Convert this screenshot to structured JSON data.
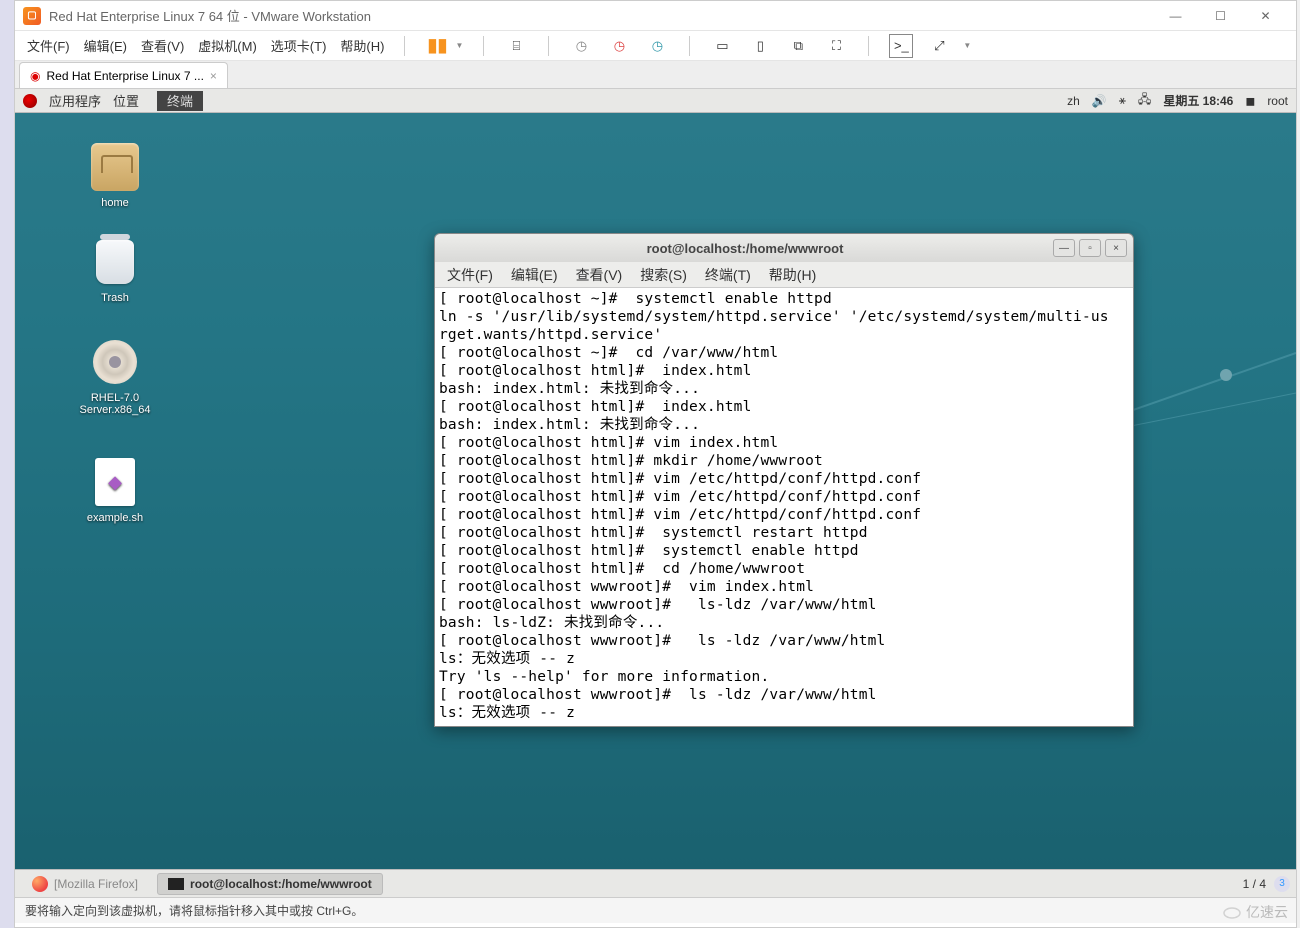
{
  "vmware": {
    "title": "Red Hat Enterprise Linux 7 64 位 - VMware Workstation",
    "menus": [
      "文件(F)",
      "编辑(E)",
      "查看(V)",
      "虚拟机(M)",
      "选项卡(T)",
      "帮助(H)"
    ],
    "tab_label": "Red Hat Enterprise Linux 7 ...",
    "statusbar": "要将输入定向到该虚拟机，请将鼠标指针移入其中或按 Ctrl+G。"
  },
  "gnome": {
    "apps_label": "应用程序",
    "places_label": "位置",
    "terminal_label": "终端",
    "lang": "zh",
    "datetime": "星期五 18:46",
    "user": "root",
    "taskbar": {
      "firefox": "[Mozilla Firefox]",
      "terminal": "root@localhost:/home/wwwroot",
      "page_indicator": "1 / 4"
    }
  },
  "desktop_icons": {
    "home": "home",
    "trash": "Trash",
    "disc": "RHEL-7.0 Server.x86_64",
    "example": "example.sh"
  },
  "terminal": {
    "title": "root@localhost:/home/wwwroot",
    "menus": [
      "文件(F)",
      "编辑(E)",
      "查看(V)",
      "搜索(S)",
      "终端(T)",
      "帮助(H)"
    ],
    "lines": [
      "[ root@localhost ~]#  systemctl enable httpd",
      "ln -s '/usr/lib/systemd/system/httpd.service' '/etc/systemd/system/multi-us",
      "rget.wants/httpd.service'",
      "[ root@localhost ~]#  cd /var/www/html",
      "[ root@localhost html]#  index.html",
      "bash: index.html: 未找到命令...",
      "[ root@localhost html]#  index.html",
      "bash: index.html: 未找到命令...",
      "[ root@localhost html]# vim index.html",
      "[ root@localhost html]# mkdir /home/wwwroot",
      "[ root@localhost html]# vim /etc/httpd/conf/httpd.conf",
      "[ root@localhost html]# vim /etc/httpd/conf/httpd.conf",
      "[ root@localhost html]# vim /etc/httpd/conf/httpd.conf",
      "[ root@localhost html]#  systemctl restart httpd",
      "[ root@localhost html]#  systemctl enable httpd",
      "[ root@localhost html]#  cd /home/wwwroot",
      "[ root@localhost wwwroot]#  vim index.html",
      "[ root@localhost wwwroot]#   ls-ldz /var/www/html",
      "bash: ls-ldZ: 未找到命令...",
      "[ root@localhost wwwroot]#   ls -ldz /var/www/html",
      "ls：无效选项 -- z",
      "Try 'ls --help' for more information.",
      "[ root@localhost wwwroot]#  ls -ldz /var/www/html",
      "ls：无效选项 -- z"
    ]
  },
  "watermark": "亿速云"
}
